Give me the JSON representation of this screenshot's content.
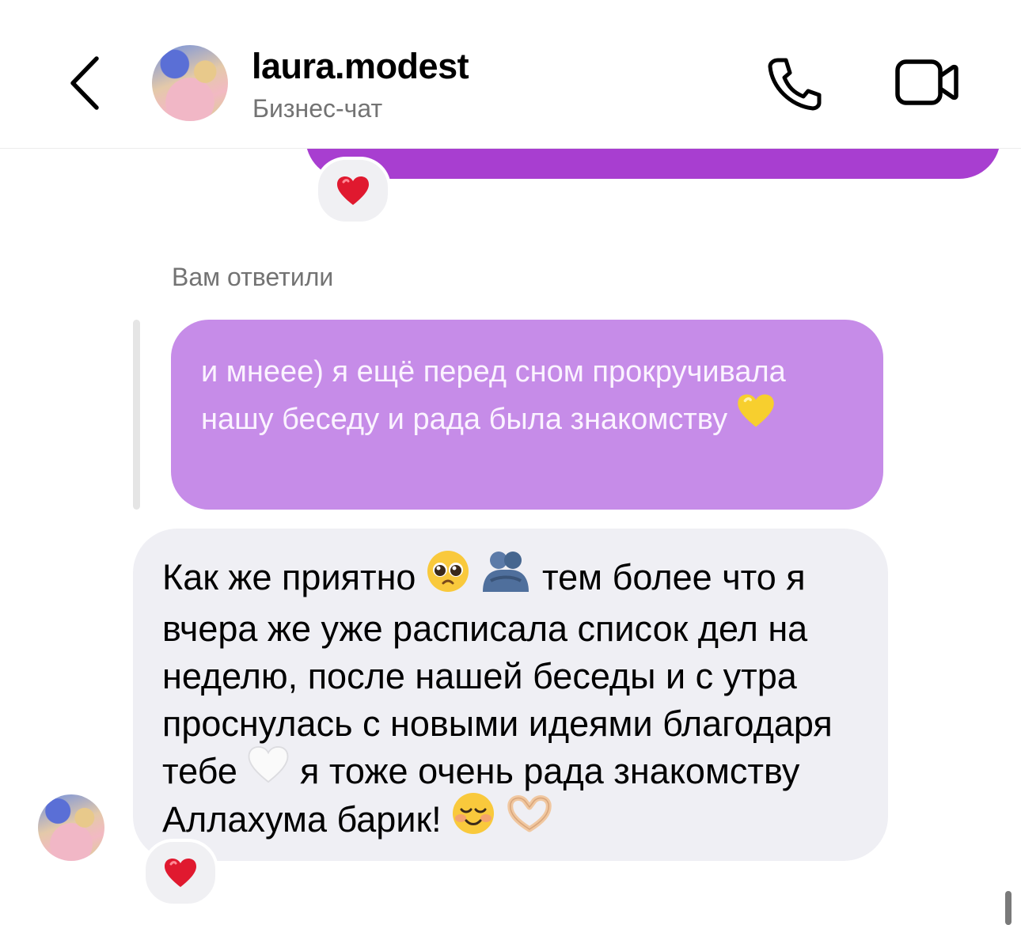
{
  "header": {
    "contact_name": "laura.modest",
    "subtitle": "Бизнес-чат",
    "icons": {
      "back": "chevron-left-icon",
      "call": "phone-icon",
      "video": "video-camera-icon"
    }
  },
  "conversation": {
    "previous_message": {
      "bubble_color": "#a83ed0",
      "reaction": "heart-reaction"
    },
    "reply_label": "Вам ответили",
    "quoted_message": {
      "text": "и мнеее) я ещё перед сном прокручивала нашу беседу и рада была знакомству",
      "emoji": "yellow-heart",
      "bubble_color": "#c68ce8"
    },
    "message": {
      "segments": [
        "Как же приятно",
        "тем более что я вчера же уже расписала список дел на неделю, после нашей беседы и с утра проснулась с новыми идеями благодаря тебе",
        "я тоже очень рада знакомству Аллахума барик!"
      ],
      "emojis": [
        "pleading-face",
        "people-hugging",
        "white-heart",
        "smiling-face",
        "heart-hands"
      ],
      "bubble_color": "#efeff4",
      "reaction": "heart-reaction"
    }
  },
  "colors": {
    "reaction_heart": "#e0192f",
    "secondary_text": "#737373"
  }
}
